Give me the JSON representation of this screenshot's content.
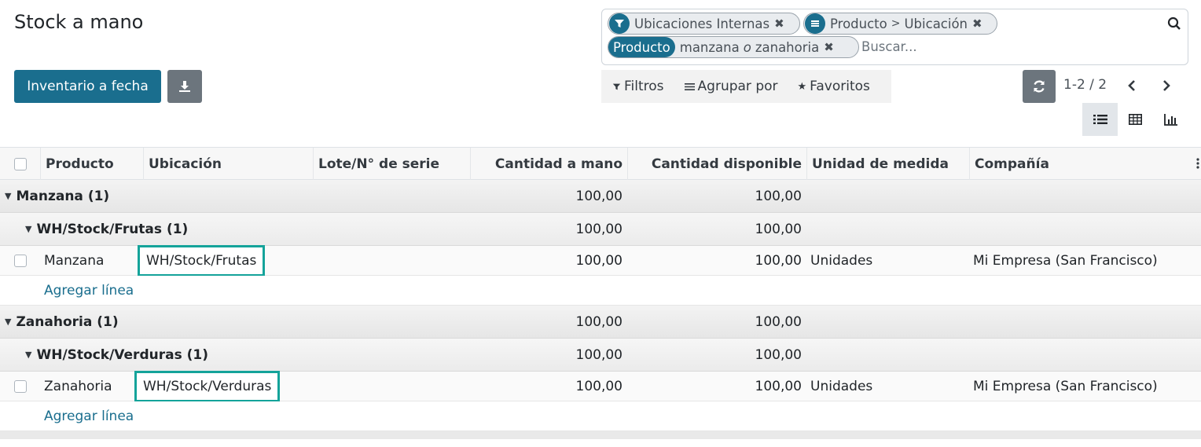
{
  "page": {
    "title": "Stock a mano"
  },
  "actions": {
    "primary_label": "Inventario a fecha"
  },
  "search": {
    "facets": [
      {
        "icon": "filter-icon",
        "text": "Ubicaciones Internas"
      },
      {
        "icon": "group-by-icon",
        "text": "Producto",
        "sep": ">",
        "text2": "Ubicación"
      },
      {
        "label": "Producto",
        "value1": "manzana",
        "conj": "o",
        "value2": "zanahoria"
      }
    ],
    "placeholder": "Buscar..."
  },
  "filterbar": {
    "filters": "Filtros",
    "group_by": "Agrupar por",
    "favorites": "Favoritos"
  },
  "pager": {
    "value": "1-2 / 2"
  },
  "views": [
    "list-view-icon",
    "pivot-view-icon",
    "graph-view-icon"
  ],
  "table": {
    "columns": [
      "Producto",
      "Ubicación",
      "Lote/N° de serie",
      "Cantidad a mano",
      "Cantidad disponible",
      "Unidad de medida",
      "Compañía"
    ],
    "groups": [
      {
        "label": "Manzana (1)",
        "on_hand": "100,00",
        "available": "100,00",
        "subgroup": {
          "label": "WH/Stock/Frutas (1)",
          "on_hand": "100,00",
          "available": "100,00",
          "row": {
            "product": "Manzana",
            "location": "WH/Stock/Frutas",
            "on_hand": "100,00",
            "available": "100,00",
            "uom": "Unidades",
            "company": "Mi Empresa (San Francisco)"
          }
        },
        "add_line": "Agregar línea"
      },
      {
        "label": "Zanahoria (1)",
        "on_hand": "100,00",
        "available": "100,00",
        "subgroup": {
          "label": "WH/Stock/Verduras (1)",
          "on_hand": "100,00",
          "available": "100,00",
          "row": {
            "product": "Zanahoria",
            "location": "WH/Stock/Verduras",
            "on_hand": "100,00",
            "available": "100,00",
            "uom": "Unidades",
            "company": "Mi Empresa (San Francisco)"
          }
        },
        "add_line": "Agregar línea"
      }
    ]
  },
  "colors": {
    "primary": "#1a6e8e",
    "secondary": "#6c757d",
    "highlight": "#14a39a"
  }
}
